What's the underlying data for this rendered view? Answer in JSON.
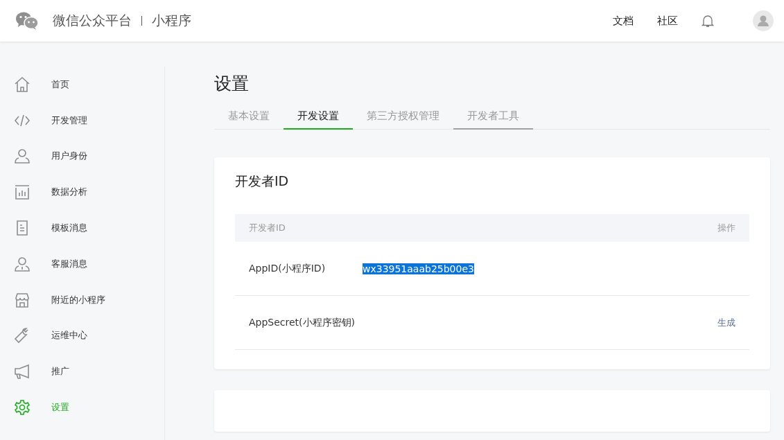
{
  "header": {
    "brand": "微信公众平台",
    "product": "小程序",
    "links": [
      "文档",
      "社区"
    ]
  },
  "sidebar": {
    "items": [
      {
        "label": "首页",
        "kind": "home",
        "selected": false
      },
      {
        "label": "开发管理",
        "kind": "code",
        "selected": false
      },
      {
        "label": "用户身份",
        "kind": "user",
        "selected": false
      },
      {
        "label": "数据分析",
        "kind": "chart",
        "selected": false
      },
      {
        "label": "模板消息",
        "kind": "doc",
        "selected": false
      },
      {
        "label": "客服消息",
        "kind": "service",
        "selected": false
      },
      {
        "label": "附近的小程序",
        "kind": "store",
        "selected": false
      },
      {
        "label": "运维中心",
        "kind": "wrench",
        "selected": false
      },
      {
        "label": "推广",
        "kind": "megaphone",
        "selected": false
      },
      {
        "label": "设置",
        "kind": "gear",
        "selected": true
      }
    ]
  },
  "page": {
    "title": "设置",
    "tabs": [
      {
        "label": "基本设置",
        "selected": false,
        "hovered": false
      },
      {
        "label": "开发设置",
        "selected": true,
        "hovered": false
      },
      {
        "label": "第三方授权管理",
        "selected": false,
        "hovered": false
      },
      {
        "label": "开发者工具",
        "selected": false,
        "hovered": true
      }
    ]
  },
  "card": {
    "title": "开发者ID",
    "columns": [
      "开发者ID",
      "操作"
    ],
    "rows": [
      {
        "name": "AppID(小程序ID)",
        "value": "wx33951aaab25b00e3",
        "highlighted": true
      },
      {
        "name": "AppSecret(小程序密钥)",
        "action": "生成"
      }
    ]
  }
}
